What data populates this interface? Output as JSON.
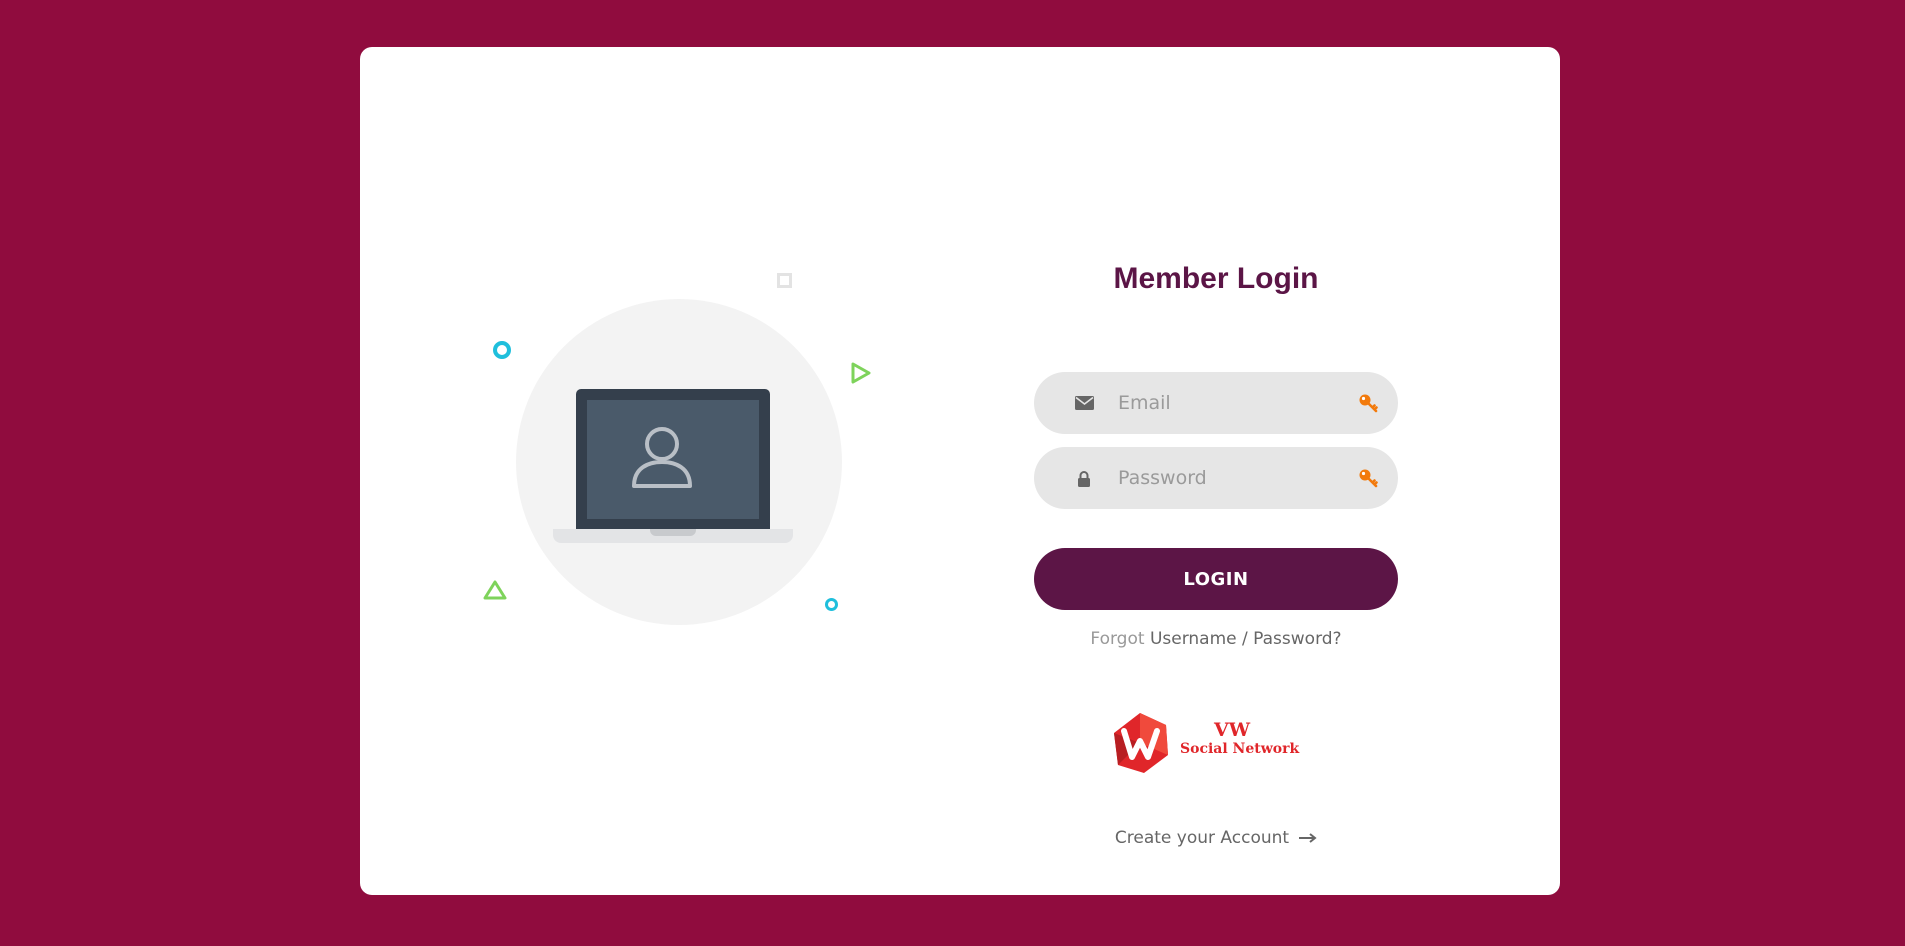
{
  "form": {
    "title": "Member Login",
    "email": {
      "placeholder": "Email",
      "value": ""
    },
    "password": {
      "placeholder": "Password",
      "value": ""
    },
    "login_label": "LOGIN",
    "forgot_prefix": "Forgot",
    "forgot_link": "Username / Password?",
    "create_account": "Create your Account"
  },
  "logo": {
    "line1": "VW",
    "line2": "Social Network"
  },
  "icons": {
    "email": "envelope-icon",
    "password": "lock-icon",
    "field_action": "key-icon",
    "create_account": "arrow-right-icon",
    "illustration": "laptop-user-icon"
  },
  "colors": {
    "page_background": "#900c3e",
    "card_background": "#ffffff",
    "title": "#5b1546",
    "button": "#5c1546",
    "field_background": "#e6e6e6",
    "key_icon": "#f27a0c",
    "logo_red": "#e0262a",
    "deco_blue": "#1fbfdc",
    "deco_green": "#7ed35b"
  }
}
